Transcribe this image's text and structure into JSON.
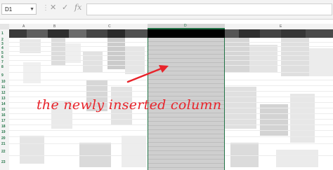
{
  "formula_bar": {
    "name_box": "D1",
    "name_box_arrow": "▼",
    "separator": "⋮",
    "cancel_icon": "✕",
    "enter_icon": "✓",
    "function_icon": "fx"
  },
  "columns": [
    "A",
    "B",
    "C",
    "D",
    "E"
  ],
  "rows": [
    "1",
    "2",
    "3",
    "4",
    "5",
    "6",
    "7",
    "8",
    "9",
    "10",
    "11",
    "12",
    "13",
    "14",
    "15",
    "16",
    "17",
    "18",
    "19",
    "20",
    "21",
    "22",
    "23"
  ],
  "annotation": {
    "text": "the newly inserted column",
    "color": "#e8232a"
  },
  "colors": {
    "accent": "#217346",
    "new_column_fill": "#cfcfcf",
    "header_fill": "#000000"
  }
}
